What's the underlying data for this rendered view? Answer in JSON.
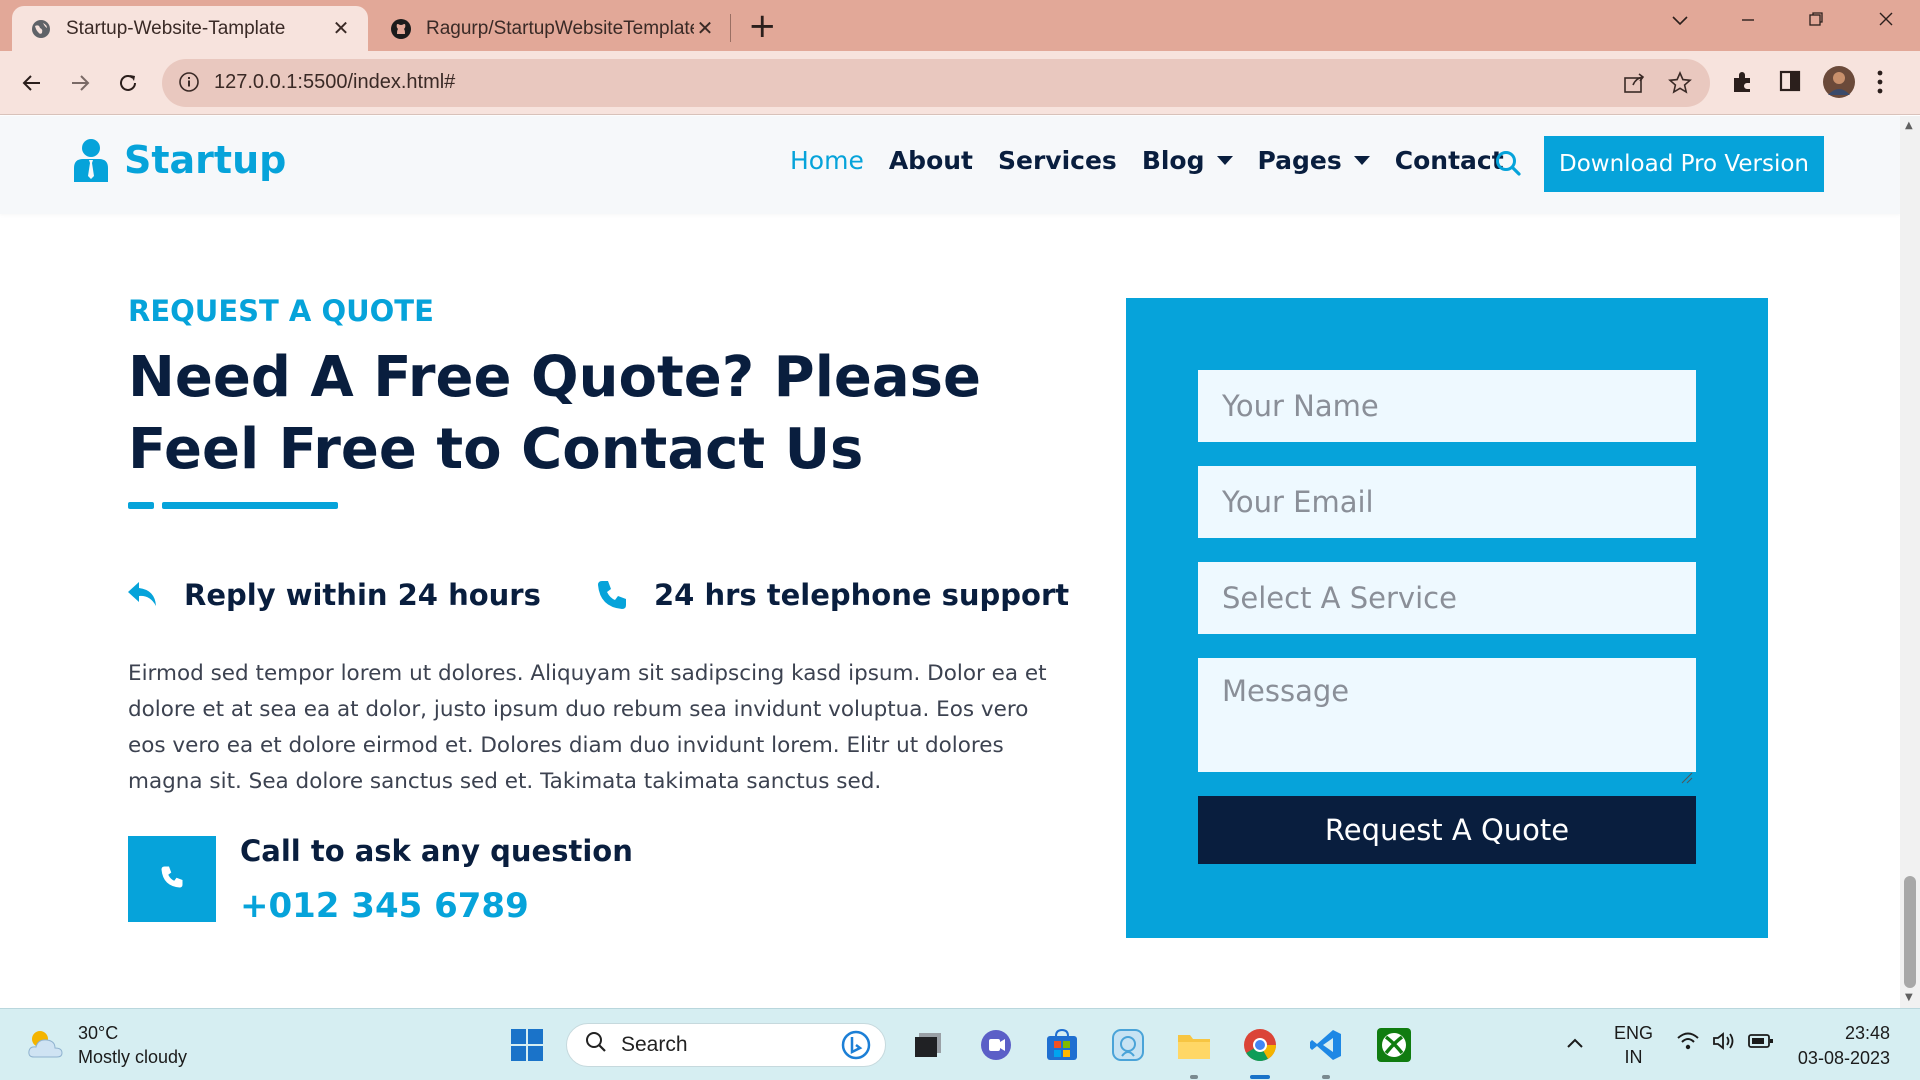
{
  "browser": {
    "tabs": [
      {
        "title": "Startup-Website-Tamplate",
        "active": true,
        "icon": "globe-icon"
      },
      {
        "title": "Ragurp/StartupWebsiteTemplate",
        "active": false,
        "icon": "github-icon"
      }
    ],
    "new_tab": "+",
    "close_glyph": "✕",
    "url": "127.0.0.1:5500/index.html#",
    "colors": {
      "tabbar": "#e2a898",
      "toolbar": "#f7e3dd"
    }
  },
  "site": {
    "brand": "Startup",
    "nav": [
      {
        "label": "Home",
        "active": true
      },
      {
        "label": "About"
      },
      {
        "label": "Services"
      },
      {
        "label": "Blog",
        "dropdown": true
      },
      {
        "label": "Pages",
        "dropdown": true
      },
      {
        "label": "Contact"
      }
    ],
    "cta": "Download Pro Version",
    "colors": {
      "primary": "#06a3da",
      "dark": "#091e3e",
      "light": "#eef9ff"
    }
  },
  "quote": {
    "eyebrow": "REQUEST A QUOTE",
    "headline": "Need A Free Quote? Please Feel Free to Contact Us",
    "features": [
      "Reply within 24 hours",
      "24 hrs telephone support"
    ],
    "description": "Eirmod sed tempor lorem ut dolores. Aliquyam sit sadipscing kasd ipsum. Dolor ea et dolore et at sea ea at dolor, justo ipsum duo rebum sea invidunt voluptua. Eos vero eos vero ea et dolore eirmod et. Dolores diam duo invidunt lorem. Elitr ut dolores magna sit. Sea dolore sanctus sed et. Takimata takimata sanctus sed.",
    "call_title": "Call to ask any question",
    "call_number": "+012 345 6789",
    "form": {
      "name_placeholder": "Your Name",
      "email_placeholder": "Your Email",
      "service_placeholder": "Select A Service",
      "message_placeholder": "Message",
      "submit": "Request A Quote"
    }
  },
  "taskbar": {
    "weather_temp": "30°C",
    "weather_desc": "Mostly cloudy",
    "search": "Search",
    "lang_1": "ENG",
    "lang_2": "IN",
    "time": "23:48",
    "date": "03-08-2023",
    "apps": [
      "windows-start-icon",
      "bing-icon",
      "file-manager-icon",
      "teams-icon",
      "store-icon",
      "photos-icon",
      "file-explorer-icon",
      "chrome-icon",
      "vscode-icon",
      "xbox-icon"
    ]
  }
}
